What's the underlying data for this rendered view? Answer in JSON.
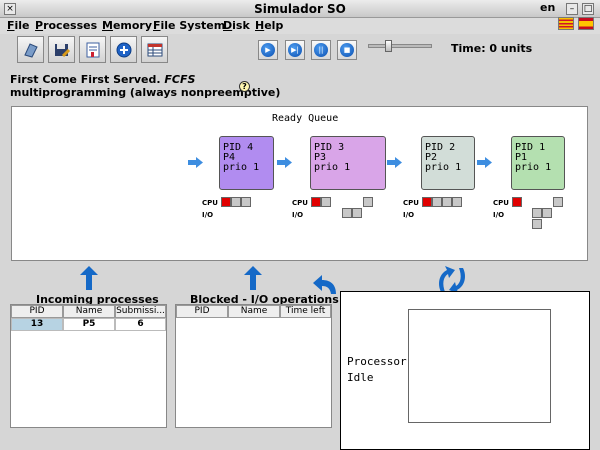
{
  "window": {
    "title": "Simulador SO"
  },
  "menu": [
    "File",
    "Processes",
    "Memory",
    "File System",
    "Disk",
    "Help"
  ],
  "language": "en",
  "time_label": "Time: 0 units",
  "algorithm": {
    "line1": "First Come First Served.",
    "line1_code": "FCFS",
    "line2": "multiprogramming (always nonpreemptive)",
    "help": "?"
  },
  "ready_queue": {
    "label": "Ready Queue",
    "cpu_label": "CPU",
    "io_label": "I/O",
    "processes": [
      {
        "pid": "PID 4",
        "name": "P4",
        "prio": "prio 1",
        "color": "#b18cf0"
      },
      {
        "pid": "PID 3",
        "name": "P3",
        "prio": "prio 1",
        "color": "#d9a5e8"
      },
      {
        "pid": "PID 2",
        "name": "P2",
        "prio": "prio 1",
        "color": "#d2ddd8"
      },
      {
        "pid": "PID 1",
        "name": "P1",
        "prio": "prio 1",
        "color": "#b4e0b0"
      }
    ]
  },
  "incoming": {
    "title": "Incoming processes",
    "headers": [
      "PID",
      "Name",
      "Submissi..."
    ],
    "rows": [
      [
        "13",
        "P5",
        "6"
      ]
    ]
  },
  "blocked": {
    "title": "Blocked - I/O operations",
    "headers": [
      "PID",
      "Name",
      "Time left"
    ]
  },
  "processor": {
    "line1": "Processor",
    "line2": "Idle"
  },
  "icons": [
    "close-icon",
    "minimize-icon",
    "maximize-icon",
    "open-icon",
    "save-icon",
    "edit-icon",
    "add-icon",
    "table-icon",
    "play-icon",
    "step-icon",
    "pause-icon",
    "stop-icon",
    "help-icon",
    "arrow-right-icon",
    "arrow-up-icon",
    "cycle-icon"
  ]
}
